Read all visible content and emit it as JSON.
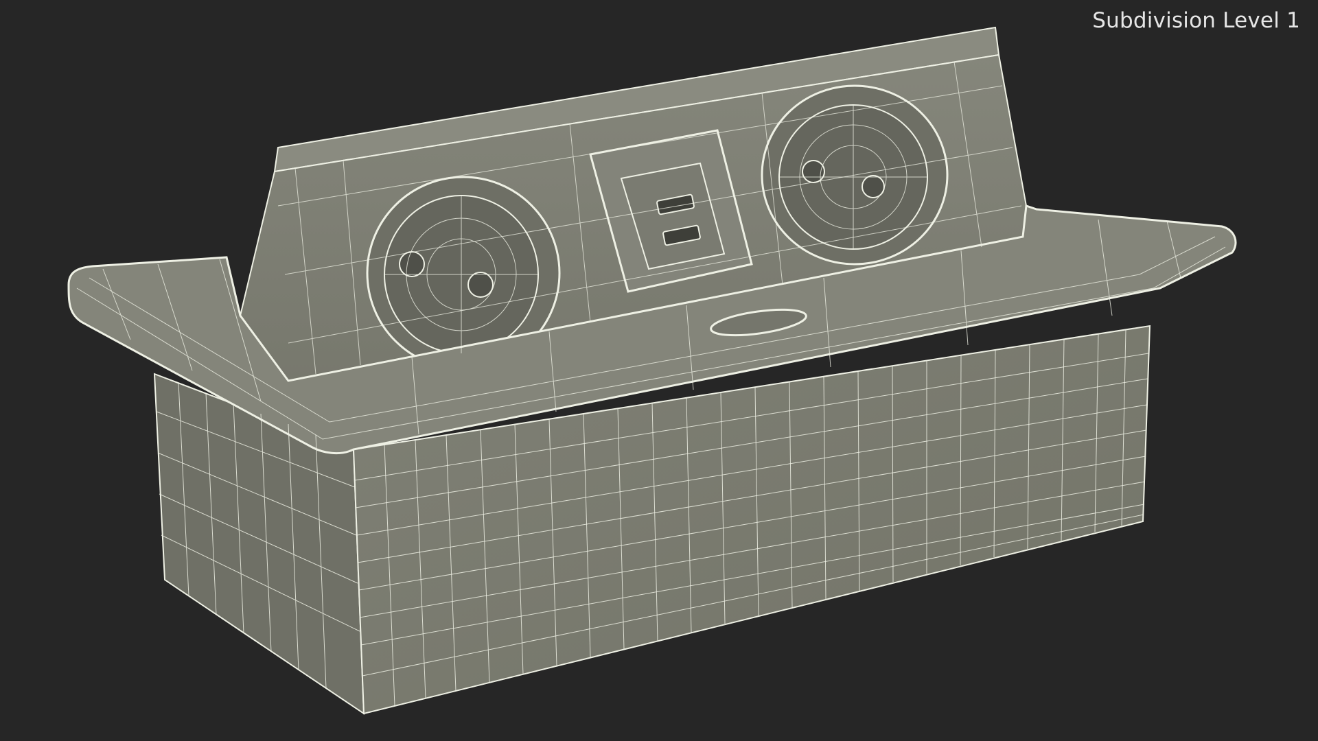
{
  "overlay": {
    "label": "Subdivision Level 1"
  },
  "scene": {
    "background_color": "#262626",
    "surface_color": "#7c7d72",
    "surface_dark_color": "#6a6b61",
    "wire_color": "#eef0e4",
    "label_color": "#e6e6e6"
  }
}
